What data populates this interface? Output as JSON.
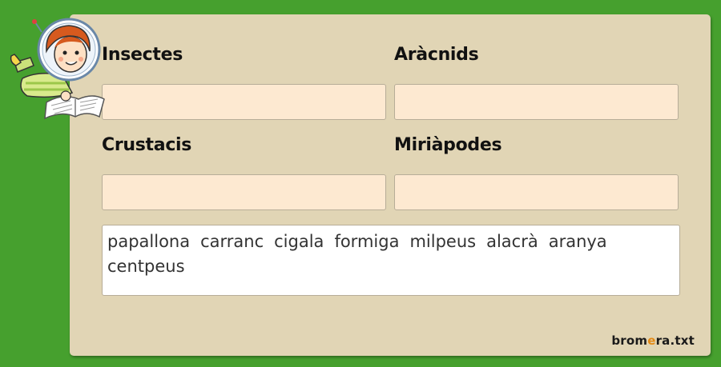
{
  "categories": [
    {
      "label": "Insectes"
    },
    {
      "label": "Aràcnids"
    },
    {
      "label": "Crustacis"
    },
    {
      "label": "Miriàpodes"
    }
  ],
  "word_bank": [
    "papallona",
    "carranc",
    "cigala",
    "formiga",
    "milpeus",
    "alacrà",
    "aranya",
    "centpeus"
  ],
  "logo": {
    "part1": "brom",
    "accent": "e",
    "part2": "ra.txt"
  },
  "colors": {
    "background": "#46a02e",
    "panel": "#e1d5b5",
    "drop_box": "#fde9d1",
    "logo_accent": "#e38a16"
  },
  "icons": {
    "mascot": "astronaut-girl-reading-book"
  }
}
